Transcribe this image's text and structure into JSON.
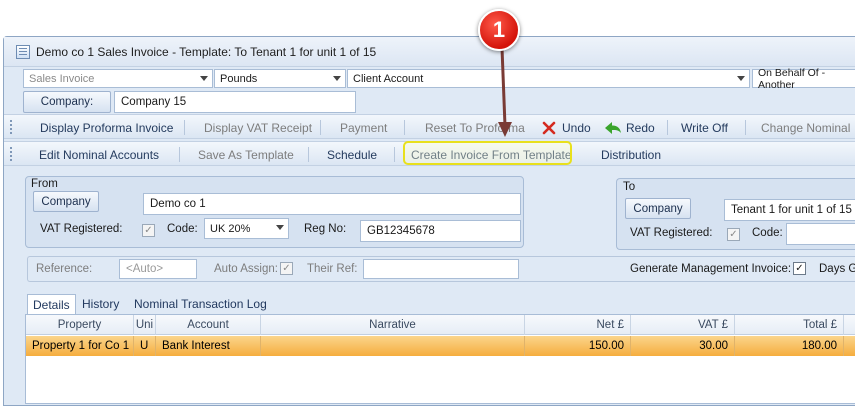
{
  "window": {
    "title": "Demo co 1 Sales Invoice - Template: To Tenant 1 for unit 1 of 15"
  },
  "header_row": {
    "invoice_type": "Sales Invoice",
    "currency": "Pounds",
    "account": "Client Account",
    "on_behalf": "On Behalf Of - Another"
  },
  "company": {
    "button": "Company:",
    "value": "Company 15"
  },
  "toolbar1": {
    "display_proforma": "Display Proforma Invoice",
    "display_vat_receipt": "Display VAT Receipt",
    "payment": "Payment",
    "reset_to_proforma": "Reset To Proforma",
    "undo": "Undo",
    "redo": "Redo",
    "write_off": "Write Off",
    "change_nominal": "Change Nominal"
  },
  "toolbar2": {
    "edit_nominal": "Edit Nominal Accounts",
    "save_as_template": "Save As Template",
    "schedule": "Schedule",
    "create_invoice": "Create  Invoice From Template",
    "distribution": "Distribution"
  },
  "from": {
    "title": "From",
    "company_button": "Company",
    "company_value": "Demo co 1",
    "vat_label": "VAT Registered:",
    "code_label": "Code:",
    "code_value": "UK 20%",
    "reg_label": "Reg No:",
    "reg_value": "GB12345678"
  },
  "to": {
    "title": "To",
    "company_button": "Company",
    "company_value": "Tenant 1 for unit 1 of 15",
    "vat_label": "VAT Registered:",
    "code_label": "Code:"
  },
  "ref_row": {
    "reference_label": "Reference:",
    "reference_placeholder": "<Auto>",
    "auto_assign_label": "Auto Assign:",
    "their_ref_label": "Their Ref:",
    "gen_mgmt_label": "Generate Management Invoice:",
    "days_label": "Days Gr"
  },
  "tabs": [
    "Details",
    "History",
    "Nominal Transaction Log"
  ],
  "table": {
    "columns": [
      "Property",
      "Uni",
      "Account",
      "Narrative",
      "Net £",
      "VAT £",
      "Total £"
    ],
    "rows": [
      {
        "property": "Property 1 for Co 1",
        "unit": "U",
        "account": "Bank Interest",
        "narrative": "",
        "net": "150.00",
        "vat": "30.00",
        "total": "180.00"
      }
    ]
  },
  "callout": {
    "number": "1"
  },
  "colors": {
    "highlight": "#e8e01c",
    "selected_row": "#f7b84a",
    "callout": "#d4140a",
    "undo": "#d42a1f",
    "redo": "#3aa52c"
  }
}
